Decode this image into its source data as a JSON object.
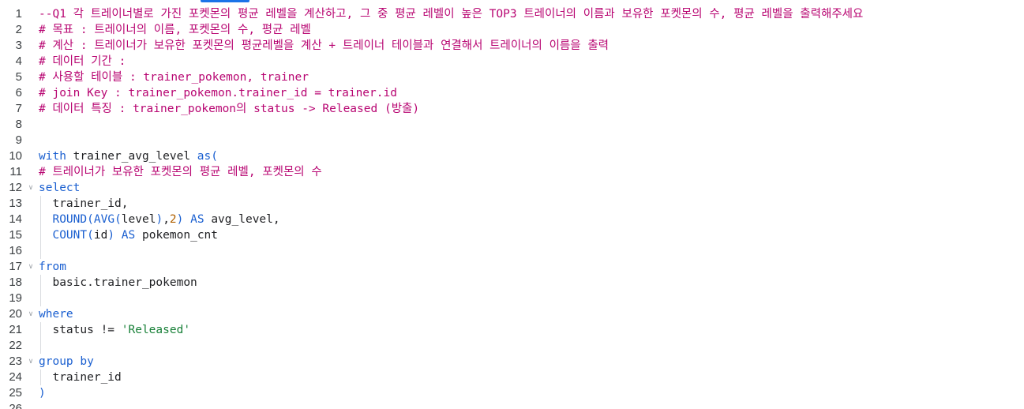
{
  "lines": [
    {
      "n": "1",
      "parts": [
        {
          "t": "--Q1 각 트레이너별로 가진 포켓몬의 평균 레벨을 계산하고, 그 중 평균 레벨이 높은 TOP3 트레이너의 이름과 보유한 포켓몬의 수, 평균 레벨을 출력해주세요",
          "c": "comment"
        }
      ]
    },
    {
      "n": "2",
      "parts": [
        {
          "t": "# 목표 : 트레이너의 이름, 포켓몬의 수, 평균 레벨",
          "c": "comment"
        }
      ]
    },
    {
      "n": "3",
      "parts": [
        {
          "t": "# 계산 : 트레이너가 보유한 포켓몬의 평균레벨을 계산 + 트레이너 테이블과 연결해서 트레이너의 이름을 출력",
          "c": "comment"
        }
      ]
    },
    {
      "n": "4",
      "parts": [
        {
          "t": "# 데이터 기간 :",
          "c": "comment"
        }
      ]
    },
    {
      "n": "5",
      "parts": [
        {
          "t": "# 사용할 테이블 : trainer_pokemon, trainer",
          "c": "comment"
        }
      ]
    },
    {
      "n": "6",
      "parts": [
        {
          "t": "# join Key : trainer_pokemon.trainer_id = trainer.id",
          "c": "comment"
        }
      ]
    },
    {
      "n": "7",
      "parts": [
        {
          "t": "# 데이터 특징 : trainer_pokemon의 status -> Released (방출)",
          "c": "comment"
        }
      ]
    },
    {
      "n": "8",
      "parts": []
    },
    {
      "n": "9",
      "parts": []
    },
    {
      "n": "10",
      "parts": [
        {
          "t": "with",
          "c": "kw"
        },
        {
          "t": " trainer_avg_level ",
          "c": "plain"
        },
        {
          "t": "as(",
          "c": "kw"
        }
      ]
    },
    {
      "n": "11",
      "parts": [
        {
          "t": "# 트레이너가 보유한 포켓몬의 평균 레벨, 포켓몬의 수",
          "c": "comment"
        }
      ]
    },
    {
      "n": "12",
      "fold": true,
      "parts": [
        {
          "t": "select",
          "c": "kw"
        }
      ]
    },
    {
      "n": "13",
      "guide": true,
      "parts": [
        {
          "t": "  trainer_id,",
          "c": "plain"
        }
      ]
    },
    {
      "n": "14",
      "guide": true,
      "parts": [
        {
          "t": "  ",
          "c": "plain"
        },
        {
          "t": "ROUND",
          "c": "fn"
        },
        {
          "t": "(",
          "c": "fn"
        },
        {
          "t": "AVG",
          "c": "fn"
        },
        {
          "t": "(",
          "c": "fn"
        },
        {
          "t": "level",
          "c": "plain"
        },
        {
          "t": ")",
          "c": "fn"
        },
        {
          "t": ",",
          "c": "plain"
        },
        {
          "t": "2",
          "c": "num"
        },
        {
          "t": ")",
          "c": "fn"
        },
        {
          "t": " AS ",
          "c": "kw"
        },
        {
          "t": "avg_level,",
          "c": "plain"
        }
      ]
    },
    {
      "n": "15",
      "guide": true,
      "parts": [
        {
          "t": "  ",
          "c": "plain"
        },
        {
          "t": "COUNT",
          "c": "fn"
        },
        {
          "t": "(",
          "c": "fn"
        },
        {
          "t": "id",
          "c": "plain"
        },
        {
          "t": ")",
          "c": "fn"
        },
        {
          "t": " AS ",
          "c": "kw"
        },
        {
          "t": "pokemon_cnt",
          "c": "plain"
        }
      ]
    },
    {
      "n": "16",
      "guide": true,
      "parts": []
    },
    {
      "n": "17",
      "fold": true,
      "parts": [
        {
          "t": "from",
          "c": "kw"
        }
      ]
    },
    {
      "n": "18",
      "guide": true,
      "parts": [
        {
          "t": "  basic.trainer_pokemon",
          "c": "plain"
        }
      ]
    },
    {
      "n": "19",
      "guide": true,
      "parts": []
    },
    {
      "n": "20",
      "fold": true,
      "parts": [
        {
          "t": "where",
          "c": "kw"
        }
      ]
    },
    {
      "n": "21",
      "guide": true,
      "parts": [
        {
          "t": "  status != ",
          "c": "plain"
        },
        {
          "t": "'Released'",
          "c": "str"
        }
      ]
    },
    {
      "n": "22",
      "guide": true,
      "parts": []
    },
    {
      "n": "23",
      "fold": true,
      "parts": [
        {
          "t": "group by",
          "c": "kw"
        }
      ]
    },
    {
      "n": "24",
      "guide": true,
      "parts": [
        {
          "t": "  trainer_id",
          "c": "plain"
        }
      ]
    },
    {
      "n": "25",
      "parts": [
        {
          "t": ")",
          "c": "kw"
        }
      ]
    },
    {
      "n": "26",
      "parts": []
    }
  ]
}
